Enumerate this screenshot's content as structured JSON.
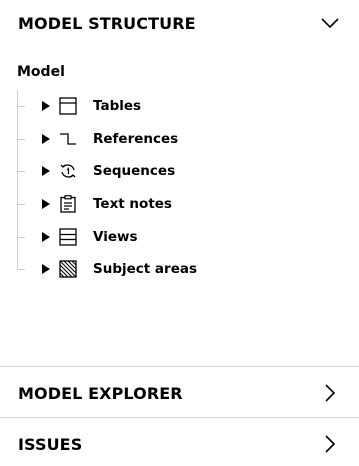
{
  "model_structure": {
    "title": "MODEL STRUCTURE",
    "expanded": true,
    "toggle_icon": "chevron-down-icon",
    "root": {
      "label": "Model",
      "items": [
        {
          "label": "Tables",
          "icon": "table-icon",
          "expanded": false
        },
        {
          "label": "References",
          "icon": "reference-icon",
          "expanded": false
        },
        {
          "label": "Sequences",
          "icon": "sequence-icon",
          "expanded": false
        },
        {
          "label": "Text notes",
          "icon": "text-note-icon",
          "expanded": false
        },
        {
          "label": "Views",
          "icon": "view-icon",
          "expanded": false
        },
        {
          "label": "Subject areas",
          "icon": "subject-area-icon",
          "expanded": false
        }
      ]
    }
  },
  "model_explorer": {
    "title": "MODEL EXPLORER",
    "expanded": false,
    "toggle_icon": "chevron-right-icon"
  },
  "issues": {
    "title": "ISSUES",
    "expanded": false,
    "toggle_icon": "chevron-right-icon"
  }
}
